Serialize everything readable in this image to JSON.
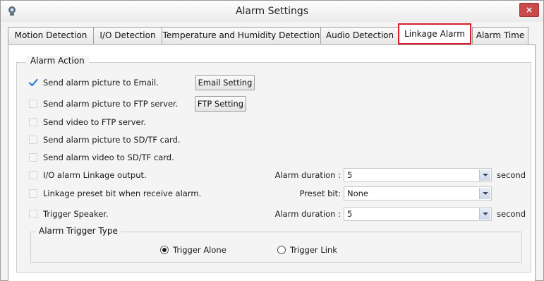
{
  "window": {
    "title": "Alarm Settings",
    "close_glyph": "×"
  },
  "tabs": [
    {
      "label": "Motion Detection",
      "active": false
    },
    {
      "label": "I/O Detection",
      "active": false
    },
    {
      "label": "Temperature and Humidity Detection",
      "active": false
    },
    {
      "label": "Audio Detection",
      "active": false
    },
    {
      "label": "Linkage Alarm",
      "active": true
    },
    {
      "label": "Alarm Time",
      "active": false
    }
  ],
  "alarm_action": {
    "legend": "Alarm Action",
    "options": [
      {
        "label": "Send alarm picture to Email.",
        "checked": true
      },
      {
        "label": "Send alarm picture to FTP server.",
        "checked": false
      },
      {
        "label": "Send video to FTP server.",
        "checked": false
      },
      {
        "label": "Send alarm picture to SD/TF card.",
        "checked": false
      },
      {
        "label": "Send alarm video to SD/TF card.",
        "checked": false
      },
      {
        "label": "I/O alarm Linkage output.",
        "checked": false
      },
      {
        "label": "Linkage preset bit when receive alarm.",
        "checked": false
      },
      {
        "label": "Trigger Speaker.",
        "checked": false
      }
    ],
    "email_setting_label": "Email Setting",
    "ftp_setting_label": "FTP Setting",
    "io_duration": {
      "label": "Alarm duration :",
      "value": "5",
      "unit": "second"
    },
    "preset": {
      "label": "Preset bit:",
      "value": "None"
    },
    "speaker_duration": {
      "label": "Alarm duration :",
      "value": "5",
      "unit": "second"
    }
  },
  "trigger_type": {
    "legend": "Alarm Trigger Type",
    "options": [
      {
        "label": "Trigger Alone",
        "selected": true
      },
      {
        "label": "Trigger Link",
        "selected": false
      }
    ]
  },
  "colors": {
    "active_tab_border": "#d81e2c",
    "check_mark": "#3a86d8",
    "close_button": "#c84a4a"
  },
  "icons": {
    "app": "camera-icon",
    "close": "close-icon",
    "check": "check-icon",
    "dropdown": "chevron-down-icon"
  }
}
